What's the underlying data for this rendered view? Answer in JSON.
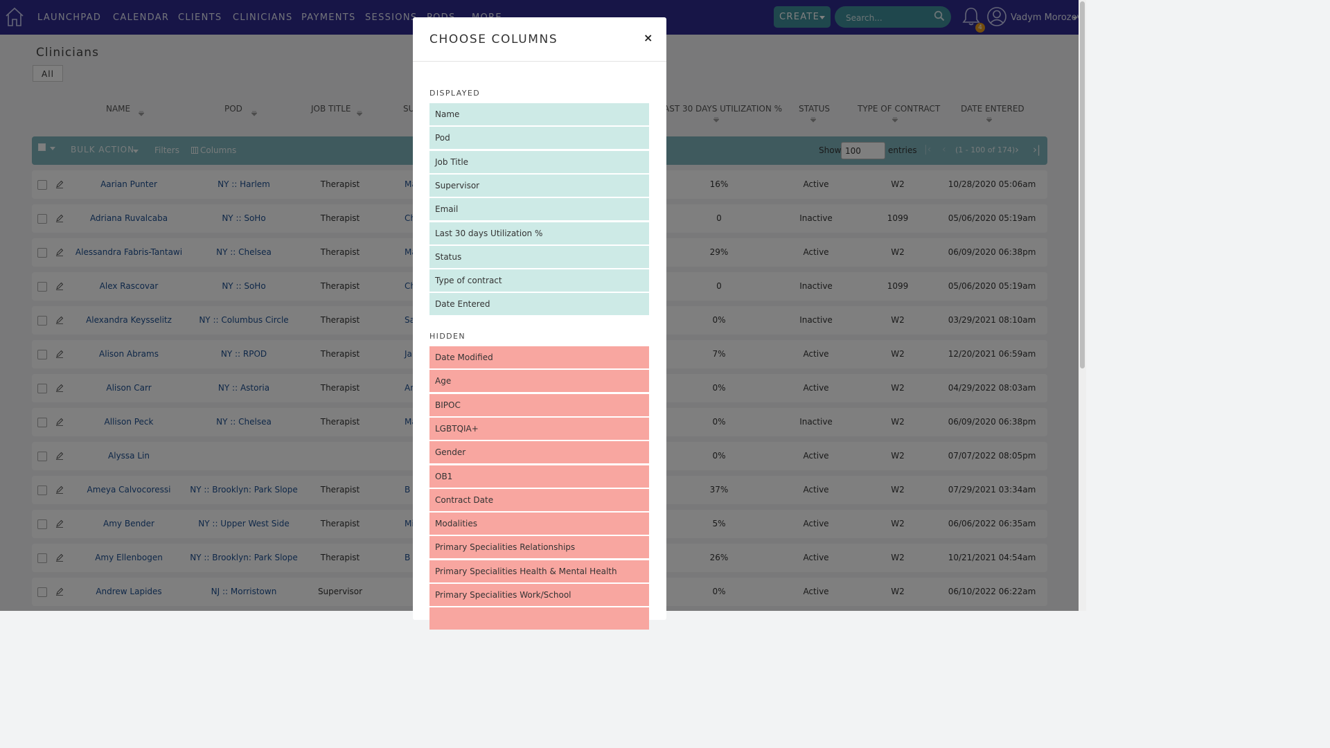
{
  "nav": {
    "items": [
      "LAUNCHPAD",
      "CALENDAR",
      "CLIENTS",
      "CLINICIANS",
      "PAYMENTS",
      "SESSIONS",
      "PODS",
      "MORE"
    ],
    "create_label": "CREATE",
    "search_placeholder": "Search...",
    "notification_count": "4",
    "user_name": "Vadym Morozov",
    "colors": {
      "bar": "#2f2b8f",
      "accent": "#3f8f9a",
      "badge": "#e89a1c"
    }
  },
  "page": {
    "title": "Clinicians",
    "filter_tab": "All",
    "columns": [
      "NAME",
      "POD",
      "JOB TITLE",
      "SU",
      "AST 30 DAYS UTILIZATION %",
      "STATUS",
      "TYPE OF CONTRACT",
      "DATE ENTERED"
    ]
  },
  "toolbar": {
    "bulk_action": "BULK ACTION",
    "filters": "Filters",
    "columns": "Columns",
    "show_label": "Show",
    "show_value": "100",
    "entries_label": "entries",
    "range": "(1 - 100 of 174)"
  },
  "rows": [
    {
      "name": "Aarian Punter",
      "pod": "NY :: Harlem",
      "job": "Therapist",
      "sup": "Marl",
      "util": "16%",
      "status": "Active",
      "contract": "W2",
      "date": "10/28/2020 05:06am"
    },
    {
      "name": "Adriana Ruvalcaba",
      "pod": "NY :: SoHo",
      "job": "Therapist",
      "sup": "Chri",
      "util": "0",
      "status": "Inactive",
      "contract": "1099",
      "date": "05/06/2020 05:19am"
    },
    {
      "name": "Alessandra Fabris-Tantawi",
      "pod": "NY :: Chelsea",
      "job": "Therapist",
      "sup": "Mar",
      "util": "29%",
      "status": "Active",
      "contract": "W2",
      "date": "06/09/2020 06:38pm"
    },
    {
      "name": "Alex Rascovar",
      "pod": "NY :: SoHo",
      "job": "Therapist",
      "sup": "Chri",
      "util": "0",
      "status": "Inactive",
      "contract": "1099",
      "date": "05/06/2020 05:19am"
    },
    {
      "name": "Alexandra Keysselitz",
      "pod": "NY :: Columbus Circle",
      "job": "Therapist",
      "sup": "Sam",
      "util": "0%",
      "status": "Inactive",
      "contract": "W2",
      "date": "03/29/2021 08:10am"
    },
    {
      "name": "Alison Abrams",
      "pod": "NY :: RPOD",
      "job": "Therapist",
      "sup": "Ja",
      "util": "7%",
      "status": "Active",
      "contract": "W2",
      "date": "12/20/2021 06:59am"
    },
    {
      "name": "Alison Carr",
      "pod": "NY :: Astoria",
      "job": "Therapist",
      "sup": "Am",
      "util": "0%",
      "status": "Active",
      "contract": "W2",
      "date": "04/29/2022 08:03am"
    },
    {
      "name": "Allison Peck",
      "pod": "NY :: Chelsea",
      "job": "Therapist",
      "sup": "Mar",
      "util": "0%",
      "status": "Inactive",
      "contract": "W2",
      "date": "06/09/2020 06:38pm"
    },
    {
      "name": "Alyssa Lin",
      "pod": "",
      "job": "",
      "sup": "",
      "util": "0%",
      "status": "Active",
      "contract": "W2",
      "date": "07/07/2022 08:05pm"
    },
    {
      "name": "Ameya Calvocoressi",
      "pod": "NY :: Brooklyn: Park Slope",
      "job": "Therapist",
      "sup": "B",
      "util": "37%",
      "status": "Active",
      "contract": "W2",
      "date": "07/29/2021 03:34am"
    },
    {
      "name": "Amy Bender",
      "pod": "NY :: Upper West Side",
      "job": "Therapist",
      "sup": "Mi",
      "util": "5%",
      "status": "Active",
      "contract": "W2",
      "date": "06/06/2022 06:35am"
    },
    {
      "name": "Amy Ellenbogen",
      "pod": "NY :: Brooklyn: Park Slope",
      "job": "Therapist",
      "sup": "B",
      "util": "26%",
      "status": "Active",
      "contract": "W2",
      "date": "10/21/2021 04:54am"
    },
    {
      "name": "Andrew Lapides",
      "pod": "NJ :: Morristown",
      "job": "Supervisor",
      "sup": "",
      "util": "0%",
      "status": "Active",
      "contract": "W2",
      "date": "06/10/2022 06:22am"
    }
  ],
  "modal": {
    "title": "CHOOSE COLUMNS",
    "close": "×",
    "displayed_label": "DISPLAYED",
    "hidden_label": "HIDDEN",
    "displayed": [
      "Name",
      "Pod",
      "Job Title",
      "Supervisor",
      "Email",
      "Last 30 days Utilization %",
      "Status",
      "Type of contract",
      "Date Entered"
    ],
    "hidden": [
      "Date Modified",
      "Age",
      "BIPOC",
      "LGBTQIA+",
      "Gender",
      "OB1",
      "Contract Date",
      "Modalities",
      "Primary Specialities Relationships",
      "Primary Specialities Health & Mental Health",
      "Primary Specialities Work/School"
    ],
    "colors": {
      "displayed": "#cdeae6",
      "hidden": "#f8a6a0"
    }
  }
}
